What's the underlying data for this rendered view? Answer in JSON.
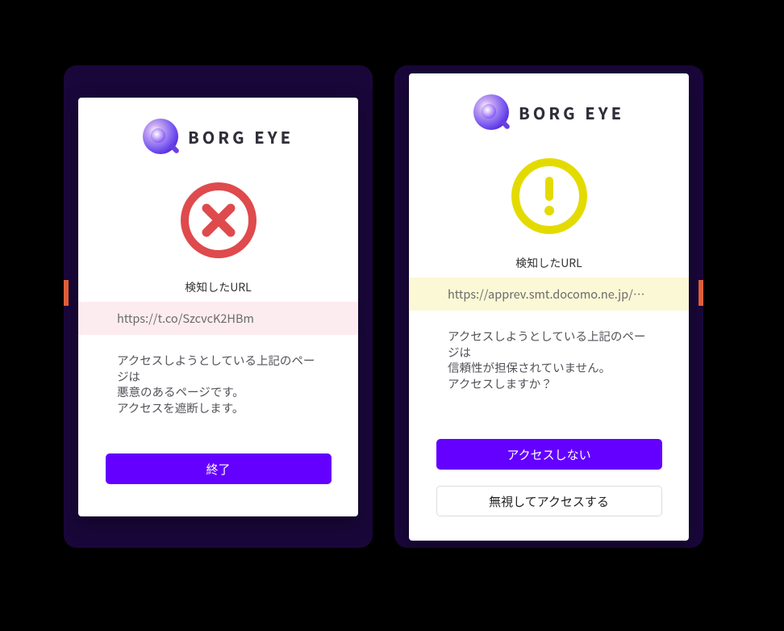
{
  "brand": {
    "name": "BORG EYE"
  },
  "colors": {
    "accent": "#6400ff",
    "danger": "#df4a4d",
    "warn": "#e3db00"
  },
  "left": {
    "detected_label": "検知したURL",
    "url": "https://t.co/SzcvcK2HBm",
    "message_line1": "アクセスしようとしている上記のページは",
    "message_line2": "悪意のあるページです。",
    "message_line3": "アクセスを遮断します。",
    "buttons": {
      "primary": "終了"
    }
  },
  "right": {
    "detected_label": "検知したURL",
    "url": "https://apprev.smt.docomo.ne.jp/n…",
    "message_line1": "アクセスしようとしている上記のページは",
    "message_line2": "信頼性が担保されていません。",
    "message_line3": "アクセスしますか？",
    "buttons": {
      "primary": "アクセスしない",
      "secondary": "無視してアクセスする"
    }
  }
}
